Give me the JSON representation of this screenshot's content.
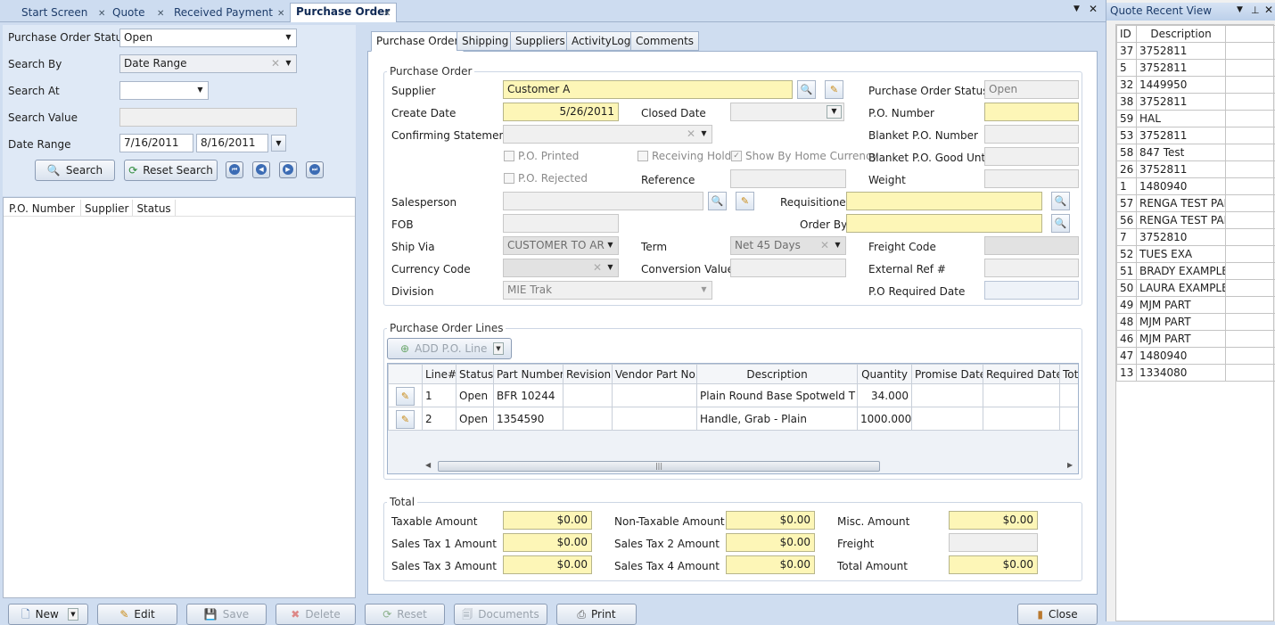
{
  "tabs": [
    {
      "label": "Start Screen"
    },
    {
      "label": "Quote"
    },
    {
      "label": "Received Payment"
    },
    {
      "label": "Purchase Order"
    }
  ],
  "search": {
    "po_status_label": "Purchase Order Status",
    "po_status_value": "Open",
    "search_by_label": "Search By",
    "search_by_value": "Date Range",
    "search_at_label": "Search At",
    "search_at_value": "",
    "search_value_label": "Search Value",
    "search_value_value": "",
    "date_range_label": "Date Range",
    "date_from": "7/16/2011",
    "date_to": "8/16/2011",
    "search_button": "Search",
    "reset_button": "Reset Search"
  },
  "result_list": {
    "columns": [
      "P.O. Number",
      "Supplier",
      "Status"
    ]
  },
  "inner_tabs": [
    "Purchase Order",
    "Shipping",
    "Suppliers",
    "ActivityLog",
    "Comments"
  ],
  "po": {
    "group_title": "Purchase Order",
    "supplier_label": "Supplier",
    "supplier_value": "Customer A",
    "create_date_label": "Create Date",
    "create_date_value": "5/26/2011",
    "closed_date_label": "Closed Date",
    "closed_date_value": "",
    "confirming_label": "Confirming Statement",
    "po_printed_label": "P.O. Printed",
    "receiving_hold_label": "Receiving Hold",
    "home_currency_label": "Show By Home Currency",
    "po_rejected_label": "P.O. Rejected",
    "reference_label": "Reference",
    "salesperson_label": "Salesperson",
    "requisitioner_label": "Requisitioner",
    "fob_label": "FOB",
    "order_by_label": "Order By",
    "ship_via_label": "Ship Via",
    "ship_via_value": "CUSTOMER TO ARR",
    "term_label": "Term",
    "term_value": "Net 45 Days",
    "currency_label": "Currency Code",
    "conversion_label": "Conversion Value",
    "division_label": "Division",
    "division_value": "MIE Trak",
    "status_label": "Purchase Order Status",
    "status_value": "Open",
    "po_number_label": "P.O. Number",
    "blanket_label": "Blanket P.O. Number",
    "blanket_good_label": "Blanket P.O. Good Until",
    "weight_label": "Weight",
    "freight_label": "Freight Code",
    "external_label": "External Ref #",
    "required_date_label": "P.O Required Date"
  },
  "lines": {
    "group_title": "Purchase Order Lines",
    "add_button": "ADD P.O. Line",
    "columns": [
      "Line#",
      "Status",
      "Part Number",
      "Revision",
      "Vendor Part No.",
      "Description",
      "Quantity",
      "Promise Date",
      "Required Date",
      "Tot"
    ],
    "rows": [
      {
        "line": "1",
        "status": "Open",
        "part": "BFR 10244",
        "revision": "",
        "vendor": "",
        "description": "Plain Round Base Spotweld T Nut",
        "quantity": "34.000",
        "promise": "",
        "required": ""
      },
      {
        "line": "2",
        "status": "Open",
        "part": "1354590",
        "revision": "",
        "vendor": "",
        "description": "Handle, Grab - Plain",
        "quantity": "1000.000",
        "promise": "",
        "required": ""
      }
    ]
  },
  "totals": {
    "group_title": "Total",
    "taxable_label": "Taxable Amount",
    "taxable_value": "$0.00",
    "nontaxable_label": "Non-Taxable Amount",
    "nontaxable_value": "$0.00",
    "misc_label": "Misc. Amount",
    "misc_value": "$0.00",
    "tax1_label": "Sales Tax 1 Amount",
    "tax1_value": "$0.00",
    "tax2_label": "Sales Tax 2 Amount",
    "tax2_value": "$0.00",
    "freight_label": "Freight",
    "freight_value": "",
    "tax3_label": "Sales Tax 3 Amount",
    "tax3_value": "$0.00",
    "tax4_label": "Sales Tax 4 Amount",
    "tax4_value": "$0.00",
    "total_label": "Total Amount",
    "total_value": "$0.00"
  },
  "bottom": {
    "new": "New",
    "edit": "Edit",
    "save": "Save",
    "delete": "Delete",
    "reset": "Reset",
    "documents": "Documents",
    "print": "Print",
    "close": "Close"
  },
  "recent": {
    "title": "Quote Recent View",
    "columns": [
      "ID",
      "Description"
    ],
    "rows": [
      {
        "id": "37",
        "desc": "3752811"
      },
      {
        "id": "5",
        "desc": "3752811"
      },
      {
        "id": "32",
        "desc": "1449950"
      },
      {
        "id": "38",
        "desc": "3752811"
      },
      {
        "id": "59",
        "desc": "HAL"
      },
      {
        "id": "53",
        "desc": "3752811"
      },
      {
        "id": "58",
        "desc": "847 Test"
      },
      {
        "id": "26",
        "desc": "3752811"
      },
      {
        "id": "1",
        "desc": "1480940"
      },
      {
        "id": "57",
        "desc": "RENGA TEST PART"
      },
      {
        "id": "56",
        "desc": "RENGA TEST PART"
      },
      {
        "id": "7",
        "desc": "3752810"
      },
      {
        "id": "52",
        "desc": "TUES EXA"
      },
      {
        "id": "51",
        "desc": "BRADY EXAMPLE"
      },
      {
        "id": "50",
        "desc": "LAURA EXAMPLE"
      },
      {
        "id": "49",
        "desc": "MJM PART"
      },
      {
        "id": "48",
        "desc": "MJM PART"
      },
      {
        "id": "46",
        "desc": "MJM PART"
      },
      {
        "id": "47",
        "desc": "1480940"
      },
      {
        "id": "13",
        "desc": "1334080"
      }
    ]
  }
}
